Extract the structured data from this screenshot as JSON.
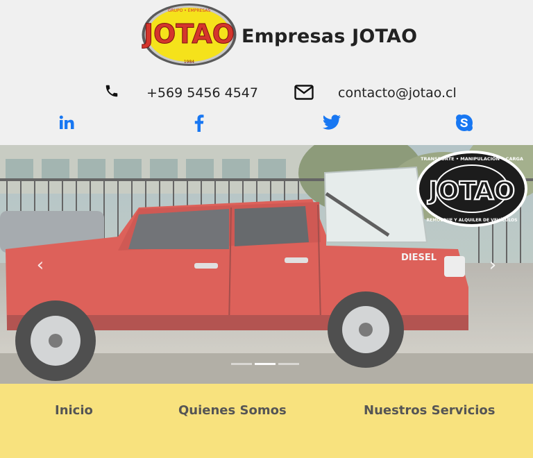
{
  "brand": {
    "logo_text": "JOTAO",
    "logo_arc_top": "GRUPO • EMPRESAS",
    "logo_year": "1984",
    "name": "Empresas JOTAO"
  },
  "contact": {
    "phone": "+569 5456 4547",
    "email": "contacto@jotao.cl"
  },
  "social": [
    "linkedin-icon",
    "facebook-icon",
    "twitter-icon",
    "skype-icon"
  ],
  "carousel": {
    "stamp_text": "JOTAO",
    "stamp_arc_top": "TRANSPORTE • MANIPULACIÓN • CARGA",
    "stamp_arc_bottom": "REMOLQUE Y ALQUILER DE VEHÍCULOS",
    "vehicle_badge": "DIESEL",
    "prev_icon": "‹",
    "next_icon": "›",
    "slides": 3,
    "active_slide": 2
  },
  "nav": {
    "inicio": "Inicio",
    "quienes": "Quienes Somos",
    "servicios": "Nuestros Servicios"
  },
  "colors": {
    "social_blue": "#1877f2",
    "nav_bg": "#f8e27e",
    "truck_red": "#d4352c",
    "logo_yellow": "#f5e21b"
  }
}
